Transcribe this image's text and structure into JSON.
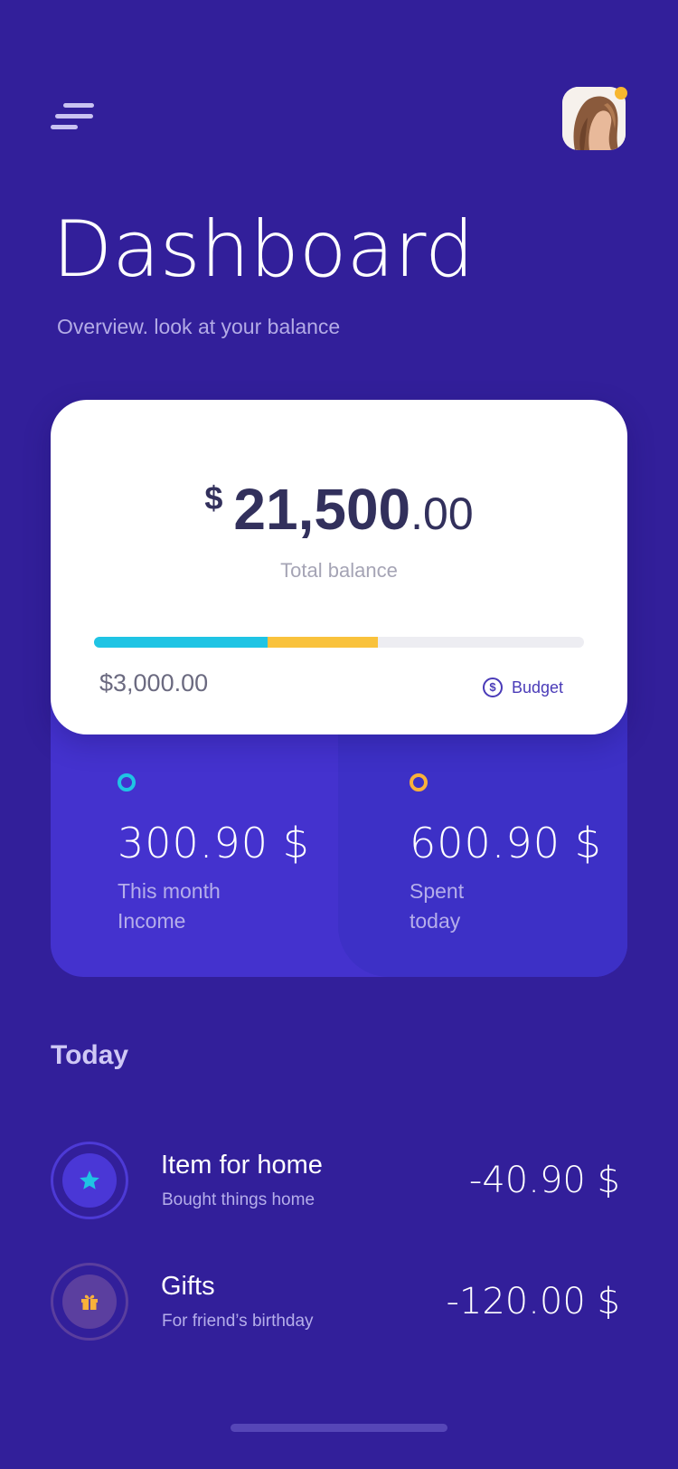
{
  "header": {
    "menu_icon": "hamburger-menu-icon",
    "avatar_icon": "user-avatar",
    "notification_color": "#F7B62F"
  },
  "page": {
    "title": "Dashboard",
    "subtitle": "Overview. look at your balance"
  },
  "balance_card": {
    "currency": "$",
    "amount_main": "21,500",
    "amount_cents": ".00",
    "label": "Total balance",
    "budget_amount": "$3,000.00",
    "budget_label": "Budget",
    "budget_icon": "dollar-circle-icon",
    "progress": {
      "income_fraction": 0.355,
      "spent_fraction": 0.225,
      "income_color": "#1FC4E4",
      "spent_color": "#F9C23C",
      "track_color": "#EDEDF2"
    }
  },
  "stats": {
    "income": {
      "value": "300.90 $",
      "label_line1": "This month",
      "label_line2": "Income",
      "dot_color": "#1FC4E4"
    },
    "spent": {
      "value": "600.90 $",
      "label_line1": "Spent",
      "label_line2": "today",
      "dot_color": "#F9B13A"
    }
  },
  "today": {
    "title": "Today",
    "transactions": [
      {
        "title": "Item for home",
        "subtitle": "Bought things home",
        "amount": "-40.90 $",
        "icon": "star-icon",
        "icon_color": "#1FC4E4"
      },
      {
        "title": "Gifts",
        "subtitle": "For friend’s birthday",
        "amount": "-120.00 $",
        "icon": "gift-icon",
        "icon_color": "#F9B13A"
      }
    ]
  },
  "colors": {
    "background": "#321F9A",
    "card": "#FFFFFF",
    "stats_panel": "#4432CE",
    "accent_text": "#B5AEEA"
  }
}
